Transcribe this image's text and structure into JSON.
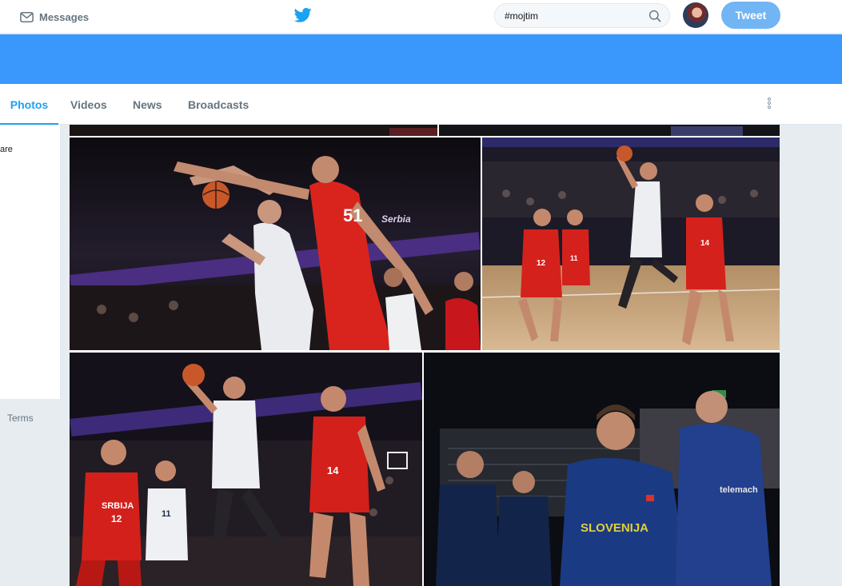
{
  "nav": {
    "messages_label": "Messages",
    "search_value": "#mojtim",
    "tweet_label": "Tweet"
  },
  "tabs": [
    {
      "label": "Photos",
      "active": true
    },
    {
      "label": "Videos",
      "active": false
    },
    {
      "label": "News",
      "active": false
    },
    {
      "label": "Broadcasts",
      "active": false
    }
  ],
  "sidebar": {
    "partial_text": "are",
    "terms_label": "Terms"
  },
  "colors": {
    "brand_blue": "#1da1f2",
    "banner": "#3a97fb",
    "tweet_button": "#71b5f4"
  },
  "photos": {
    "photo1_jersey_number": "51",
    "photo2_number_left": "12",
    "photo2_number_mid": "11",
    "photo2_number_right": "14",
    "photo3_number_left": "12",
    "photo3_number_mid": "11",
    "photo3_number_right": "14",
    "photo3_team_text": "SRBIJA",
    "photo4_team_text": "SLOVENIJA",
    "photo4_sponsor_text": "telemach",
    "court_banner_text": "Serbia"
  }
}
